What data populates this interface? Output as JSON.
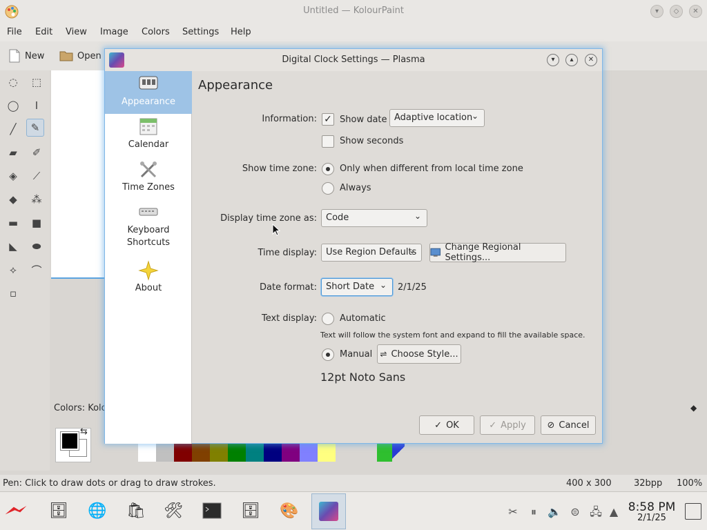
{
  "kolourpaint": {
    "title": "Untitled — KolourPaint",
    "menus": [
      "File",
      "Edit",
      "View",
      "Image",
      "Colors",
      "Settings",
      "Help"
    ],
    "toolbar": {
      "new_label": "New",
      "open_label": "Open"
    },
    "colors_label": "Colors: Kolo",
    "status": {
      "hint": "Pen: Click to draw dots or drag to draw strokes.",
      "size": "400 x 300",
      "depth": "32bpp",
      "zoom": "100%"
    },
    "palette": [
      "#ffffff",
      "#c0c0c0",
      "#800000",
      "#804000",
      "#808000",
      "#008000",
      "#008080",
      "#000080",
      "#800080",
      "#8080ff",
      "#ffff80"
    ]
  },
  "dialog": {
    "title": "Digital Clock Settings — Plasma",
    "sidebar": {
      "items": [
        {
          "label": "Appearance",
          "icon": "appearance-icon"
        },
        {
          "label": "Calendar",
          "icon": "calendar-icon"
        },
        {
          "label": "Time Zones",
          "icon": "time-zones-icon"
        },
        {
          "label": "Keyboard\nShortcuts",
          "icon": "keyboard-icon"
        },
        {
          "label": "About",
          "icon": "star-icon"
        }
      ]
    },
    "panel": {
      "heading": "Appearance",
      "information": {
        "label": "Information:",
        "show_date": "Show date",
        "show_date_checked": true,
        "date_location": "Adaptive location",
        "show_seconds": "Show seconds",
        "show_seconds_checked": false
      },
      "time_zone": {
        "label": "Show time zone:",
        "option_only_different": "Only when different from local time zone",
        "option_always": "Always",
        "selected": "only_different"
      },
      "display_tz": {
        "label": "Display time zone as:",
        "value": "Code"
      },
      "time_display": {
        "label": "Time display:",
        "value": "Use Region Defaults",
        "button": "Change Regional Settings..."
      },
      "date_format": {
        "label": "Date format:",
        "value": "Short Date",
        "preview": "2/1/25"
      },
      "text_display": {
        "label": "Text display:",
        "option_automatic": "Automatic",
        "automatic_hint": "Text will follow the system font and expand to fill the available space.",
        "option_manual": "Manual",
        "choose_style": "Choose Style...",
        "font_summary": "12pt Noto Sans",
        "selected": "manual"
      }
    },
    "buttons": {
      "ok": "OK",
      "apply": "Apply",
      "cancel": "Cancel"
    }
  },
  "taskbar": {
    "clock_time": "8:58 PM",
    "clock_date": "2/1/25"
  }
}
